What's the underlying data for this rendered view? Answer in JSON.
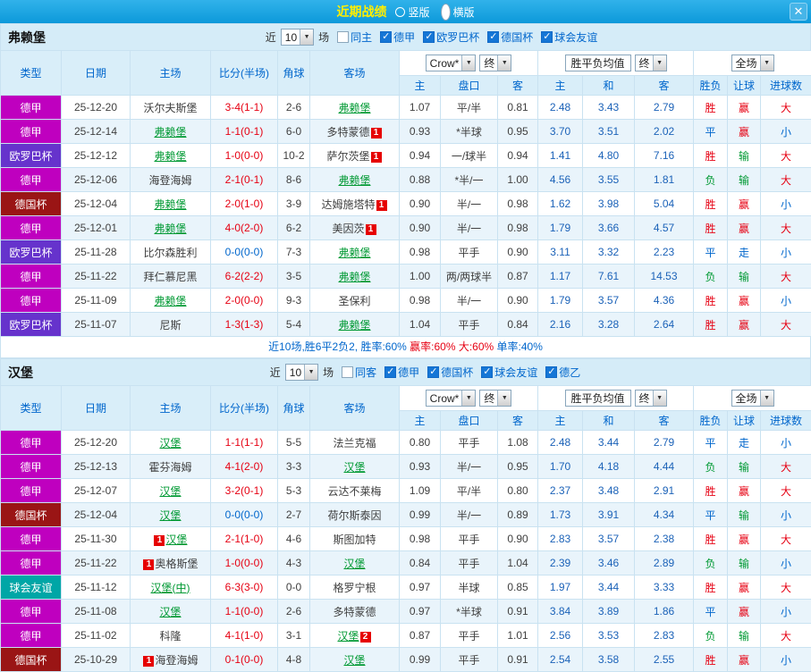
{
  "colors": {
    "accent_blue": "#0066cc",
    "win_red": "#e60012",
    "lose_green": "#009933",
    "draw_blue": "#0066cc",
    "focal_green": "#009933",
    "badge_red": "#e60000",
    "type_colors": {
      "德甲": "#bf00bf",
      "欧罗巴杯": "#6633cc",
      "德国杯": "#9a1515",
      "球会友谊": "#00a6a6"
    }
  },
  "titlebar": {
    "title": "近期战绩",
    "layout_options": [
      {
        "label": "竖版",
        "selected": false
      },
      {
        "label": "横版",
        "selected": true
      }
    ],
    "close_icon": "✕"
  },
  "table_headers": {
    "left": [
      "类型",
      "日期",
      "主场",
      "比分(半场)",
      "角球",
      "客场"
    ],
    "odds_select": "Crow*",
    "final_select": "终",
    "avg_label": "胜平负均值",
    "scope_select": "全场",
    "odds_sub": [
      "主",
      "盘口",
      "客"
    ],
    "avg_sub": [
      "主",
      "和",
      "客"
    ],
    "result_sub": [
      "胜负",
      "让球",
      "进球数"
    ]
  },
  "sections": [
    {
      "team": "弗赖堡",
      "filter": {
        "near_label": "近",
        "count": "10",
        "games_label": "场",
        "checkboxes": [
          {
            "label": "同主",
            "checked": false
          },
          {
            "label": "德甲",
            "checked": true
          },
          {
            "label": "欧罗巴杯",
            "checked": true
          },
          {
            "label": "德国杯",
            "checked": true
          },
          {
            "label": "球会友谊",
            "checked": true
          }
        ]
      },
      "rows": [
        {
          "type": "德甲",
          "date": "25-12-20",
          "home": {
            "name": "沃尔夫斯堡"
          },
          "score": "3-4(1-1)",
          "score_color": "r",
          "corner": "2-6",
          "away": {
            "name": "弗赖堡",
            "focal": true
          },
          "odds": [
            "1.07",
            "平/半",
            "0.81"
          ],
          "avg": [
            "2.48",
            "3.43",
            "2.79"
          ],
          "results": [
            {
              "t": "胜",
              "c": "r"
            },
            {
              "t": "赢",
              "c": "r"
            },
            {
              "t": "大",
              "c": "r"
            }
          ]
        },
        {
          "type": "德甲",
          "date": "25-12-14",
          "home": {
            "name": "弗赖堡",
            "focal": true
          },
          "score": "1-1(0-1)",
          "score_color": "r",
          "corner": "6-0",
          "away": {
            "name": "多特蒙德",
            "badge": "1",
            "badge_pos": "after"
          },
          "odds": [
            "0.93",
            "*半球",
            "0.95"
          ],
          "avg": [
            "3.70",
            "3.51",
            "2.02"
          ],
          "results": [
            {
              "t": "平",
              "c": "b"
            },
            {
              "t": "赢",
              "c": "r"
            },
            {
              "t": "小",
              "c": "b"
            }
          ]
        },
        {
          "type": "欧罗巴杯",
          "date": "25-12-12",
          "home": {
            "name": "弗赖堡",
            "focal": true
          },
          "score": "1-0(0-0)",
          "score_color": "r",
          "corner": "10-2",
          "away": {
            "name": "萨尔茨堡",
            "badge": "1",
            "badge_pos": "after"
          },
          "odds": [
            "0.94",
            "一/球半",
            "0.94"
          ],
          "avg": [
            "1.41",
            "4.80",
            "7.16"
          ],
          "results": [
            {
              "t": "胜",
              "c": "r"
            },
            {
              "t": "输",
              "c": "g"
            },
            {
              "t": "大",
              "c": "r"
            }
          ]
        },
        {
          "type": "德甲",
          "date": "25-12-06",
          "home": {
            "name": "海登海姆"
          },
          "score": "2-1(0-1)",
          "score_color": "r",
          "corner": "8-6",
          "away": {
            "name": "弗赖堡",
            "focal": true
          },
          "odds": [
            "0.88",
            "*半/一",
            "1.00"
          ],
          "avg": [
            "4.56",
            "3.55",
            "1.81"
          ],
          "results": [
            {
              "t": "负",
              "c": "g"
            },
            {
              "t": "输",
              "c": "g"
            },
            {
              "t": "大",
              "c": "r"
            }
          ]
        },
        {
          "type": "德国杯",
          "date": "25-12-04",
          "home": {
            "name": "弗赖堡",
            "focal": true
          },
          "score": "2-0(1-0)",
          "score_color": "r",
          "corner": "3-9",
          "away": {
            "name": "达姆施塔特",
            "badge": "1",
            "badge_pos": "after"
          },
          "odds": [
            "0.90",
            "半/一",
            "0.98"
          ],
          "avg": [
            "1.62",
            "3.98",
            "5.04"
          ],
          "results": [
            {
              "t": "胜",
              "c": "r"
            },
            {
              "t": "赢",
              "c": "r"
            },
            {
              "t": "小",
              "c": "b"
            }
          ]
        },
        {
          "type": "德甲",
          "date": "25-12-01",
          "home": {
            "name": "弗赖堡",
            "focal": true
          },
          "score": "4-0(2-0)",
          "score_color": "r",
          "corner": "6-2",
          "away": {
            "name": "美因茨",
            "badge": "1",
            "badge_pos": "after"
          },
          "odds": [
            "0.90",
            "半/一",
            "0.98"
          ],
          "avg": [
            "1.79",
            "3.66",
            "4.57"
          ],
          "results": [
            {
              "t": "胜",
              "c": "r"
            },
            {
              "t": "赢",
              "c": "r"
            },
            {
              "t": "大",
              "c": "r"
            }
          ]
        },
        {
          "type": "欧罗巴杯",
          "date": "25-11-28",
          "home": {
            "name": "比尔森胜利"
          },
          "score": "0-0(0-0)",
          "score_color": "b",
          "corner": "7-3",
          "away": {
            "name": "弗赖堡",
            "focal": true
          },
          "odds": [
            "0.98",
            "平手",
            "0.90"
          ],
          "avg": [
            "3.11",
            "3.32",
            "2.23"
          ],
          "results": [
            {
              "t": "平",
              "c": "b"
            },
            {
              "t": "走",
              "c": "b"
            },
            {
              "t": "小",
              "c": "b"
            }
          ]
        },
        {
          "type": "德甲",
          "date": "25-11-22",
          "home": {
            "name": "拜仁慕尼黑"
          },
          "score": "6-2(2-2)",
          "score_color": "r",
          "corner": "3-5",
          "away": {
            "name": "弗赖堡",
            "focal": true
          },
          "odds": [
            "1.00",
            "两/两球半",
            "0.87"
          ],
          "avg": [
            "1.17",
            "7.61",
            "14.53"
          ],
          "results": [
            {
              "t": "负",
              "c": "g"
            },
            {
              "t": "输",
              "c": "g"
            },
            {
              "t": "大",
              "c": "r"
            }
          ]
        },
        {
          "type": "德甲",
          "date": "25-11-09",
          "home": {
            "name": "弗赖堡",
            "focal": true
          },
          "score": "2-0(0-0)",
          "score_color": "r",
          "corner": "9-3",
          "away": {
            "name": "圣保利"
          },
          "odds": [
            "0.98",
            "半/一",
            "0.90"
          ],
          "avg": [
            "1.79",
            "3.57",
            "4.36"
          ],
          "results": [
            {
              "t": "胜",
              "c": "r"
            },
            {
              "t": "赢",
              "c": "r"
            },
            {
              "t": "小",
              "c": "b"
            }
          ]
        },
        {
          "type": "欧罗巴杯",
          "date": "25-11-07",
          "home": {
            "name": "尼斯"
          },
          "score": "1-3(1-3)",
          "score_color": "r",
          "corner": "5-4",
          "away": {
            "name": "弗赖堡",
            "focal": true
          },
          "odds": [
            "1.04",
            "平手",
            "0.84"
          ],
          "avg": [
            "2.16",
            "3.28",
            "2.64"
          ],
          "results": [
            {
              "t": "胜",
              "c": "r"
            },
            {
              "t": "赢",
              "c": "r"
            },
            {
              "t": "大",
              "c": "r"
            }
          ]
        }
      ],
      "summary": [
        {
          "text": "近10场,胜6平2负2, ",
          "c": "b"
        },
        {
          "text": "胜率:60% ",
          "c": "b"
        },
        {
          "text": "赢率:60% ",
          "c": "r"
        },
        {
          "text": "大:60% ",
          "c": "r"
        },
        {
          "text": "单率:40%",
          "c": "b"
        }
      ]
    },
    {
      "team": "汉堡",
      "filter": {
        "near_label": "近",
        "count": "10",
        "games_label": "场",
        "checkboxes": [
          {
            "label": "同客",
            "checked": false
          },
          {
            "label": "德甲",
            "checked": true
          },
          {
            "label": "德国杯",
            "checked": true
          },
          {
            "label": "球会友谊",
            "checked": true
          },
          {
            "label": "德乙",
            "checked": true
          }
        ]
      },
      "rows": [
        {
          "type": "德甲",
          "date": "25-12-20",
          "home": {
            "name": "汉堡",
            "focal": true
          },
          "score": "1-1(1-1)",
          "score_color": "r",
          "corner": "5-5",
          "away": {
            "name": "法兰克福"
          },
          "odds": [
            "0.80",
            "平手",
            "1.08"
          ],
          "avg": [
            "2.48",
            "3.44",
            "2.79"
          ],
          "results": [
            {
              "t": "平",
              "c": "b"
            },
            {
              "t": "走",
              "c": "b"
            },
            {
              "t": "小",
              "c": "b"
            }
          ]
        },
        {
          "type": "德甲",
          "date": "25-12-13",
          "home": {
            "name": "霍芬海姆"
          },
          "score": "4-1(2-0)",
          "score_color": "r",
          "corner": "3-3",
          "away": {
            "name": "汉堡",
            "focal": true
          },
          "odds": [
            "0.93",
            "半/一",
            "0.95"
          ],
          "avg": [
            "1.70",
            "4.18",
            "4.44"
          ],
          "results": [
            {
              "t": "负",
              "c": "g"
            },
            {
              "t": "输",
              "c": "g"
            },
            {
              "t": "大",
              "c": "r"
            }
          ]
        },
        {
          "type": "德甲",
          "date": "25-12-07",
          "home": {
            "name": "汉堡",
            "focal": true
          },
          "score": "3-2(0-1)",
          "score_color": "r",
          "corner": "5-3",
          "away": {
            "name": "云达不莱梅"
          },
          "odds": [
            "1.09",
            "平/半",
            "0.80"
          ],
          "avg": [
            "2.37",
            "3.48",
            "2.91"
          ],
          "results": [
            {
              "t": "胜",
              "c": "r"
            },
            {
              "t": "赢",
              "c": "r"
            },
            {
              "t": "大",
              "c": "r"
            }
          ]
        },
        {
          "type": "德国杯",
          "date": "25-12-04",
          "home": {
            "name": "汉堡",
            "focal": true
          },
          "score": "0-0(0-0)",
          "score_color": "b",
          "corner": "2-7",
          "away": {
            "name": "荷尔斯泰因"
          },
          "odds": [
            "0.99",
            "半/一",
            "0.89"
          ],
          "avg": [
            "1.73",
            "3.91",
            "4.34"
          ],
          "results": [
            {
              "t": "平",
              "c": "b"
            },
            {
              "t": "输",
              "c": "g"
            },
            {
              "t": "小",
              "c": "b"
            }
          ]
        },
        {
          "type": "德甲",
          "date": "25-11-30",
          "home": {
            "name": "汉堡",
            "focal": true,
            "badge": "1",
            "badge_pos": "before"
          },
          "score": "2-1(1-0)",
          "score_color": "r",
          "corner": "4-6",
          "away": {
            "name": "斯图加特"
          },
          "odds": [
            "0.98",
            "平手",
            "0.90"
          ],
          "avg": [
            "2.83",
            "3.57",
            "2.38"
          ],
          "results": [
            {
              "t": "胜",
              "c": "r"
            },
            {
              "t": "赢",
              "c": "r"
            },
            {
              "t": "大",
              "c": "r"
            }
          ]
        },
        {
          "type": "德甲",
          "date": "25-11-22",
          "home": {
            "name": "奥格斯堡",
            "badge": "1",
            "badge_pos": "before"
          },
          "score": "1-0(0-0)",
          "score_color": "r",
          "corner": "4-3",
          "away": {
            "name": "汉堡",
            "focal": true
          },
          "odds": [
            "0.84",
            "平手",
            "1.04"
          ],
          "avg": [
            "2.39",
            "3.46",
            "2.89"
          ],
          "results": [
            {
              "t": "负",
              "c": "g"
            },
            {
              "t": "输",
              "c": "g"
            },
            {
              "t": "小",
              "c": "b"
            }
          ]
        },
        {
          "type": "球会友谊",
          "date": "25-11-12",
          "home": {
            "name": "汉堡(中)",
            "focal": true
          },
          "score": "6-3(3-0)",
          "score_color": "r",
          "corner": "0-0",
          "away": {
            "name": "格罗宁根"
          },
          "odds": [
            "0.97",
            "半球",
            "0.85"
          ],
          "avg": [
            "1.97",
            "3.44",
            "3.33"
          ],
          "results": [
            {
              "t": "胜",
              "c": "r"
            },
            {
              "t": "赢",
              "c": "r"
            },
            {
              "t": "大",
              "c": "r"
            }
          ]
        },
        {
          "type": "德甲",
          "date": "25-11-08",
          "home": {
            "name": "汉堡",
            "focal": true
          },
          "score": "1-1(0-0)",
          "score_color": "r",
          "corner": "2-6",
          "away": {
            "name": "多特蒙德"
          },
          "odds": [
            "0.97",
            "*半球",
            "0.91"
          ],
          "avg": [
            "3.84",
            "3.89",
            "1.86"
          ],
          "results": [
            {
              "t": "平",
              "c": "b"
            },
            {
              "t": "赢",
              "c": "r"
            },
            {
              "t": "小",
              "c": "b"
            }
          ]
        },
        {
          "type": "德甲",
          "date": "25-11-02",
          "home": {
            "name": "科隆"
          },
          "score": "4-1(1-0)",
          "score_color": "r",
          "corner": "3-1",
          "away": {
            "name": "汉堡",
            "focal": true,
            "badge": "2",
            "badge_pos": "after"
          },
          "odds": [
            "0.87",
            "平手",
            "1.01"
          ],
          "avg": [
            "2.56",
            "3.53",
            "2.83"
          ],
          "results": [
            {
              "t": "负",
              "c": "g"
            },
            {
              "t": "输",
              "c": "g"
            },
            {
              "t": "大",
              "c": "r"
            }
          ]
        },
        {
          "type": "德国杯",
          "date": "25-10-29",
          "home": {
            "name": "海登海姆",
            "badge": "1",
            "badge_pos": "before"
          },
          "score": "0-1(0-0)",
          "score_color": "r",
          "corner": "4-8",
          "away": {
            "name": "汉堡",
            "focal": true
          },
          "odds": [
            "0.99",
            "平手",
            "0.91"
          ],
          "avg": [
            "2.54",
            "3.58",
            "2.55"
          ],
          "results": [
            {
              "t": "胜",
              "c": "r"
            },
            {
              "t": "赢",
              "c": "r"
            },
            {
              "t": "小",
              "c": "b"
            }
          ]
        }
      ]
    }
  ]
}
